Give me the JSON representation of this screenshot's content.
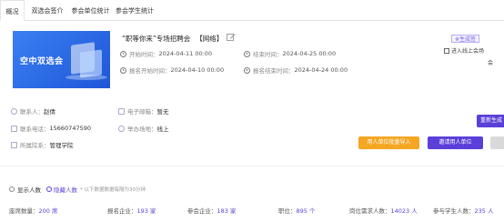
{
  "tabs": [
    "概况",
    "双选会签介",
    "参会单位统计",
    "参会学生统计"
  ],
  "banner": {
    "title": "空中双选会"
  },
  "event": {
    "title": "“职等你来”专场招聘会",
    "format": "【网络】",
    "start_label": "开始时间：",
    "start_value": "2024-04-11 00:00",
    "end_label": "结束时间：",
    "end_value": "2024-04-25 00:00",
    "reg_start_label": "报名开始时间：",
    "reg_start_value": "2024-04-10 00:00",
    "reg_end_label": "报名结束时间：",
    "reg_end_value": "2024-04-24 00:00"
  },
  "side": {
    "status": "※生成签",
    "enter_link": "进入线上会场",
    "fragment": "会"
  },
  "contact": {
    "person_label": "联系人：",
    "person_value": "赵倩",
    "email_label": "电子邮箱：",
    "email_value": "暂无",
    "phone_label": "联系电话：",
    "phone_value": "15660747590",
    "venue_label": "举办场地：",
    "venue_value": "线上",
    "college_label": "所属院系：",
    "college_value": "管理学院"
  },
  "buttons": {
    "regen": "重新生成",
    "employer_import": "用人单位批量导入",
    "invite": "邀请用人单位"
  },
  "display": {
    "label": "显示人数",
    "hidden": "隐藏人数",
    "tip": "* 以下数据数据每隔为30分钟"
  },
  "stats": [
    {
      "label": "座席数量：",
      "value": "200 席"
    },
    {
      "label": "报名企业：",
      "value": "193 家"
    },
    {
      "label": "参会企业：",
      "value": "183 家"
    },
    {
      "label": "职位：",
      "value": "895 个"
    },
    {
      "label": "岗位需求人数：",
      "value": "14023 人"
    },
    {
      "label": "参与学生人数：",
      "value": "235 人"
    }
  ]
}
